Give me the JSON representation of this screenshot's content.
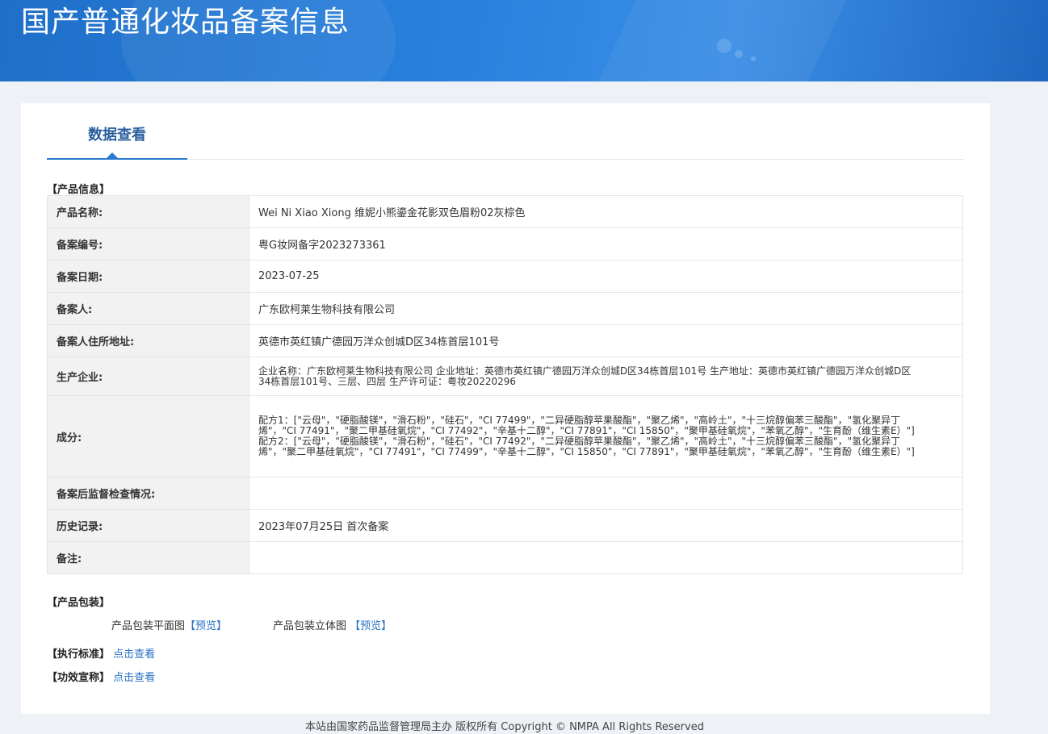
{
  "header": {
    "title": "国产普通化妆品备案信息"
  },
  "tabs": [
    {
      "label": "数据查看"
    }
  ],
  "product_info": {
    "section_title": "【产品信息】",
    "rows": [
      {
        "label": "产品名称:",
        "value": "Wei Ni Xiao Xiong 维妮小熊鎏金花影双色眉粉02灰棕色"
      },
      {
        "label": "备案编号:",
        "value": "粤G妆网备字2023273361"
      },
      {
        "label": "备案日期:",
        "value": "2023-07-25"
      },
      {
        "label": "备案人:",
        "value": "广东欧柯莱生物科技有限公司"
      },
      {
        "label": "备案人住所地址:",
        "value": "英德市英红镇广德园万洋众创城D区34栋首层101号"
      },
      {
        "label": "生产企业:",
        "value": "企业名称：广东欧柯莱生物科技有限公司 企业地址：英德市英红镇广德园万洋众创城D区34栋首层101号 生产地址：英德市英红镇广德园万洋众创城D区34栋首层101号、三层、四层 生产许可证：粤妆20220296"
      },
      {
        "label": "成分:",
        "value_lines": [
          "配方1：[\"云母\"，\"硬脂酸镁\"，\"滑石粉\"，\"硅石\"，\"CI 77499\"，\"二异硬脂醇苹果酸酯\"，\"聚乙烯\"，\"高岭土\"，\"十三烷醇偏苯三酸酯\"，\"氢化聚异丁烯\"，\"CI 77491\"，\"聚二甲基硅氧烷\"，\"CI 77492\"，\"辛基十二醇\"，\"CI 77891\"，\"CI 15850\"，\"聚甲基硅氧烷\"，\"苯氧乙醇\"，\"生育酚（维生素E）\"]",
          "配方2：[\"云母\"，\"硬脂酸镁\"，\"滑石粉\"，\"硅石\"，\"CI 77492\"，\"二异硬脂醇苹果酸酯\"，\"聚乙烯\"，\"高岭土\"，\"十三烷醇偏苯三酸酯\"，\"氢化聚异丁烯\"，\"聚二甲基硅氧烷\"，\"CI 77491\"，\"CI 77499\"，\"辛基十二醇\"，\"CI 15850\"，\"CI 77891\"，\"聚甲基硅氧烷\"，\"苯氧乙醇\"，\"生育酚（维生素E）\"]"
        ]
      },
      {
        "label": "备案后监督检查情况:",
        "value": ""
      },
      {
        "label": "历史记录:",
        "value": "2023年07月25日 首次备案"
      },
      {
        "label": "备注:",
        "value": ""
      }
    ]
  },
  "packaging": {
    "section_title": "【产品包装】",
    "flat_label": "产品包装平面图",
    "flat_link": "【预览】",
    "stereo_label": "产品包装立体图",
    "stereo_link": "【预览】"
  },
  "standard": {
    "section_title": "【执行标准】",
    "link": "点击查看"
  },
  "efficacy": {
    "section_title": "【功效宣称】",
    "link": "点击查看"
  },
  "footer": {
    "text": "本站由国家药品监督管理局主办 版权所有 Copyright © NMPA All Rights Reserved"
  }
}
